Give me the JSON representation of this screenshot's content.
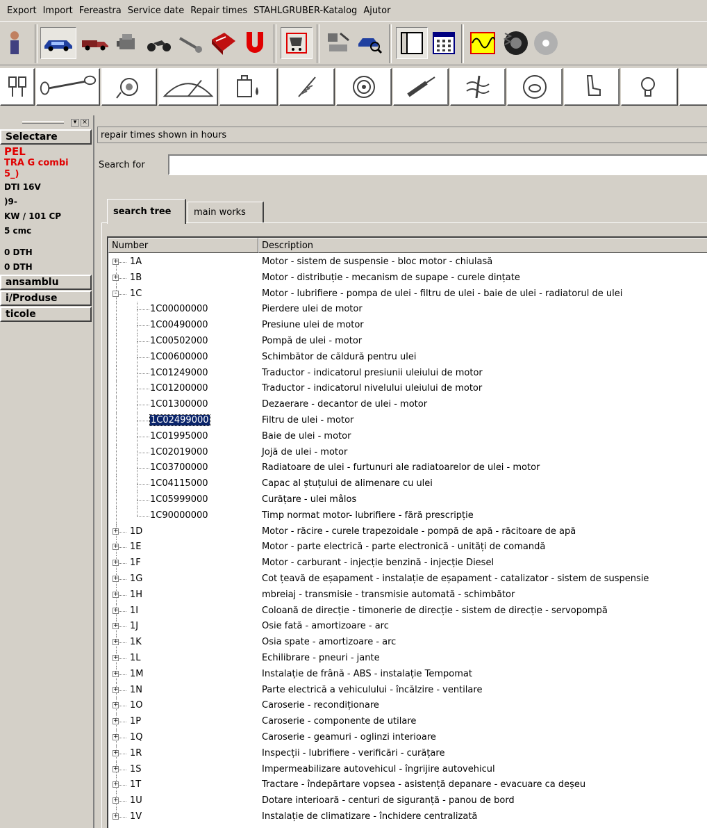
{
  "menu": [
    "Export",
    "Import",
    "Fereastra",
    "Service date",
    "Repair times",
    "STAHLGRUBER-Katalog",
    "Ajutor"
  ],
  "toolbar1": {
    "icons": [
      "person-icon",
      "car-icon",
      "truck-icon",
      "engine-icon",
      "motorcycle-icon",
      "wrench-icon",
      "book-icon",
      "magnet-icon",
      "cart-icon",
      "parts-icon",
      "car-search-icon",
      "window-layout-icon",
      "calculator-icon",
      "waveform-icon",
      "tire-icon",
      "disc-icon"
    ]
  },
  "toolbar2": {
    "icons": [
      "piston-icon",
      "axle-icon",
      "gearbox-icon",
      "wiper-icon",
      "oil-can-icon",
      "spring-icon",
      "brake-disc-icon",
      "exhaust-icon",
      "thermometer-icon",
      "steering-wheel-icon",
      "seat-icon",
      "light-bulb-icon"
    ]
  },
  "left_panel": {
    "select_label": "Selectare",
    "vehicle_lines": [
      "PEL",
      "TRA G combi",
      "5_)"
    ],
    "info_lines": [
      "DTI 16V",
      ")9-",
      "KW / 101 CP",
      "5 cmc",
      "",
      "0 DTH",
      "0 DTH"
    ],
    "buttons": [
      "ansamblu",
      "i/Produse",
      "ticole"
    ]
  },
  "main": {
    "repair_note": "repair times shown in hours",
    "search_label": "Search for",
    "search_value": "",
    "tabs": [
      "search tree",
      "main works"
    ],
    "columns": [
      "Number",
      "Description"
    ],
    "rows": [
      {
        "num": "1A",
        "desc": "Motor - sistem de suspensie - bloc motor - chiulasă",
        "level": 0,
        "expand": "+"
      },
      {
        "num": "1B",
        "desc": "Motor - distribuție - mecanism de supape - curele dințate",
        "level": 0,
        "expand": "+"
      },
      {
        "num": "1C",
        "desc": "Motor - lubrifiere - pompa de ulei - filtru de ulei - baie de ulei - radiatorul de ulei",
        "level": 0,
        "expand": "-"
      },
      {
        "num": "1C00000000",
        "desc": "Pierdere ulei de motor",
        "level": 1
      },
      {
        "num": "1C00490000",
        "desc": "Presiune ulei de motor",
        "level": 1
      },
      {
        "num": "1C00502000",
        "desc": "Pompă de ulei - motor",
        "level": 1
      },
      {
        "num": "1C00600000",
        "desc": "Schimbător de căldură pentru ulei",
        "level": 1
      },
      {
        "num": "1C01249000",
        "desc": "Traductor - indicatorul presiunii uleiului de motor",
        "level": 1
      },
      {
        "num": "1C01200000",
        "desc": "Traductor - indicatorul nivelului uleiului de motor",
        "level": 1
      },
      {
        "num": "1C01300000",
        "desc": "Dezaerare - decantor de ulei - motor",
        "level": 1
      },
      {
        "num": "1C02499000",
        "desc": "Filtru de ulei - motor",
        "level": 1,
        "selected": true
      },
      {
        "num": "1C01995000",
        "desc": "Baie de ulei - motor",
        "level": 1
      },
      {
        "num": "1C02019000",
        "desc": "Jojă de ulei - motor",
        "level": 1
      },
      {
        "num": "1C03700000",
        "desc": "Radiatoare de ulei - furtunuri ale radiatoarelor de ulei - motor",
        "level": 1
      },
      {
        "num": "1C04115000",
        "desc": "Capac al ștuțului de alimenare cu ulei",
        "level": 1
      },
      {
        "num": "1C05999000",
        "desc": "Curățare - ulei mâlos",
        "level": 1
      },
      {
        "num": "1C90000000",
        "desc": "Timp normat motor- lubrifiere - fără prescripție",
        "level": 1,
        "last": true
      },
      {
        "num": "1D",
        "desc": "Motor - răcire - curele trapezoidale - pompă de apă - răcitoare de apă",
        "level": 0,
        "expand": "+"
      },
      {
        "num": "1E",
        "desc": "Motor - parte electrică - parte electronică - unități de comandă",
        "level": 0,
        "expand": "+"
      },
      {
        "num": "1F",
        "desc": "Motor - carburant - injecție benzină - injecție Diesel",
        "level": 0,
        "expand": "+"
      },
      {
        "num": "1G",
        "desc": "Cot țeavă de eșapament - instalație de eșapament - catalizator - sistem de suspensie",
        "level": 0,
        "expand": "+"
      },
      {
        "num": "1H",
        "desc": "mbreiaj - transmisie - transmisie automată - schimbător",
        "level": 0,
        "expand": "+"
      },
      {
        "num": "1I",
        "desc": "Coloană de direcție - timonerie de direcție - sistem de direcție - servopompă",
        "level": 0,
        "expand": "+"
      },
      {
        "num": "1J",
        "desc": "Osie fată - amortizoare - arc",
        "level": 0,
        "expand": "+"
      },
      {
        "num": "1K",
        "desc": "Osia spate - amortizoare - arc",
        "level": 0,
        "expand": "+"
      },
      {
        "num": "1L",
        "desc": "Echilibrare - pneuri - jante",
        "level": 0,
        "expand": "+"
      },
      {
        "num": "1M",
        "desc": "Instalație de frână - ABS - instalație Tempomat",
        "level": 0,
        "expand": "+"
      },
      {
        "num": "1N",
        "desc": "Parte electrică a vehiculului - încălzire - ventilare",
        "level": 0,
        "expand": "+"
      },
      {
        "num": "1O",
        "desc": "Caroserie - recondiționare",
        "level": 0,
        "expand": "+"
      },
      {
        "num": "1P",
        "desc": "Caroserie - componente de utilare",
        "level": 0,
        "expand": "+"
      },
      {
        "num": "1Q",
        "desc": "Caroserie - geamuri - oglinzi interioare",
        "level": 0,
        "expand": "+"
      },
      {
        "num": "1R",
        "desc": "Inspecții - lubrifiere - verificări - curățare",
        "level": 0,
        "expand": "+"
      },
      {
        "num": "1S",
        "desc": "Impermeabilizare autovehicul - îngrijire autovehicul",
        "level": 0,
        "expand": "+"
      },
      {
        "num": "1T",
        "desc": "Tractare - îndepărtare vopsea - asistență depanare - evacuare ca deșeu",
        "level": 0,
        "expand": "+"
      },
      {
        "num": "1U",
        "desc": "Dotare interioară - centuri de siguranță - panou de bord",
        "level": 0,
        "expand": "+"
      },
      {
        "num": "1V",
        "desc": "Instalație de climatizare - închidere centralizată",
        "level": 0,
        "expand": "+"
      }
    ]
  },
  "colors": {
    "window_bg": "#d4d0c8",
    "selection": "#0a246a",
    "vehicle_red": "#e00000"
  }
}
